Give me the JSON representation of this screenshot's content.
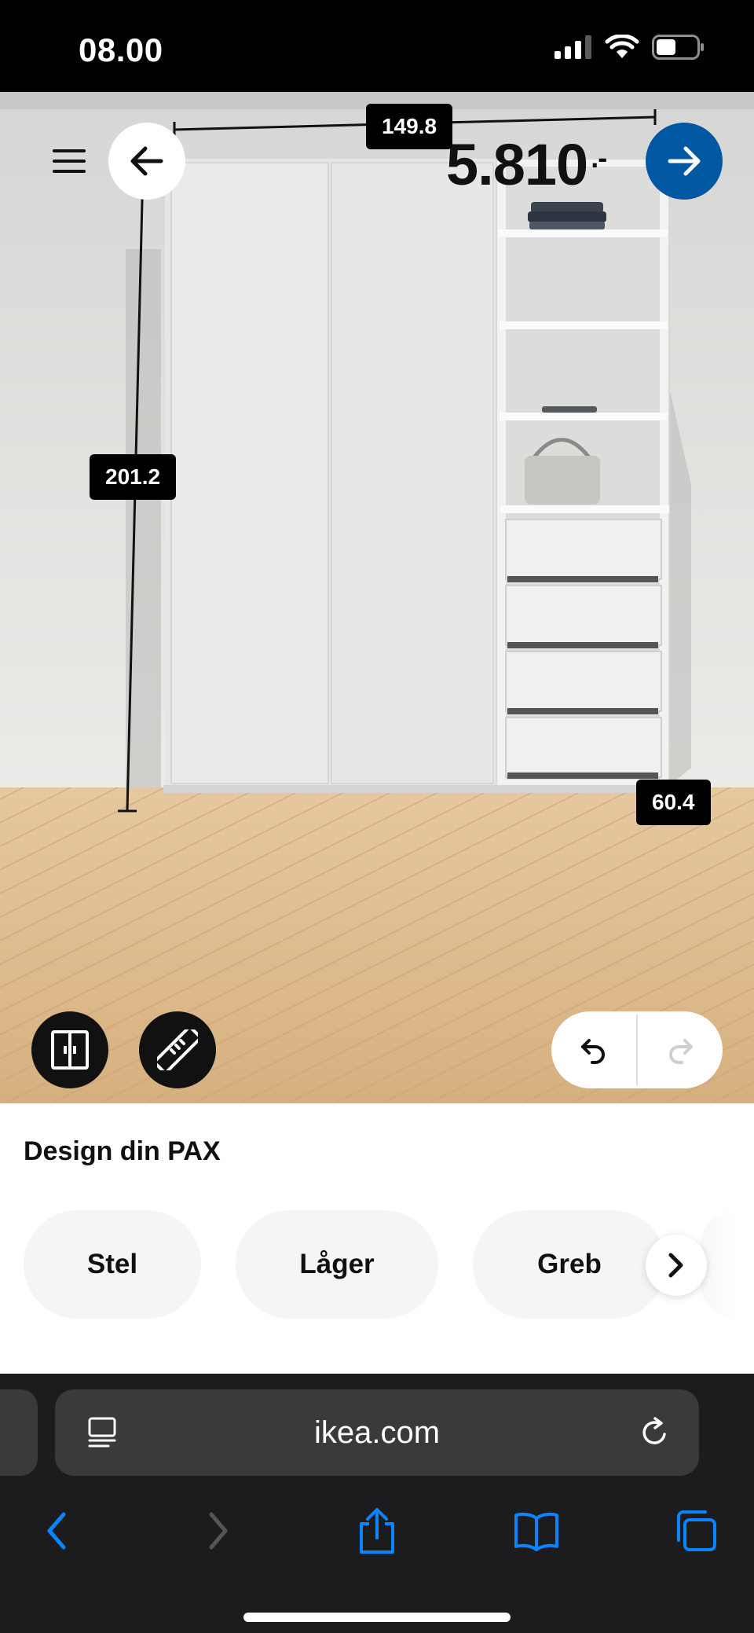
{
  "status_bar": {
    "time": "08.00",
    "icons": [
      "cellular-signal-icon",
      "wifi-icon",
      "battery-icon"
    ]
  },
  "header": {
    "price_value": "5.810",
    "price_suffix": ".-",
    "icons": [
      "menu-icon",
      "arrow-left-icon",
      "arrow-right-icon"
    ],
    "accent_color": "#0058a3"
  },
  "dimensions": {
    "width": "149.8",
    "height": "201.2",
    "depth": "60.4"
  },
  "scene_tools": {
    "icons": [
      "wardrobe-doors-icon",
      "ruler-icon",
      "undo-icon",
      "redo-icon"
    ]
  },
  "panel": {
    "title": "Design din PAX",
    "chips": [
      "Stel",
      "Låger",
      "Greb"
    ],
    "scroll_icon": "chevron-right-icon"
  },
  "browser": {
    "url": "ikea.com",
    "icons": [
      "reader-icon",
      "reload-icon",
      "back-icon",
      "forward-icon",
      "share-icon",
      "bookmarks-icon",
      "tabs-icon"
    ],
    "tint_color": "#0a84ff"
  }
}
